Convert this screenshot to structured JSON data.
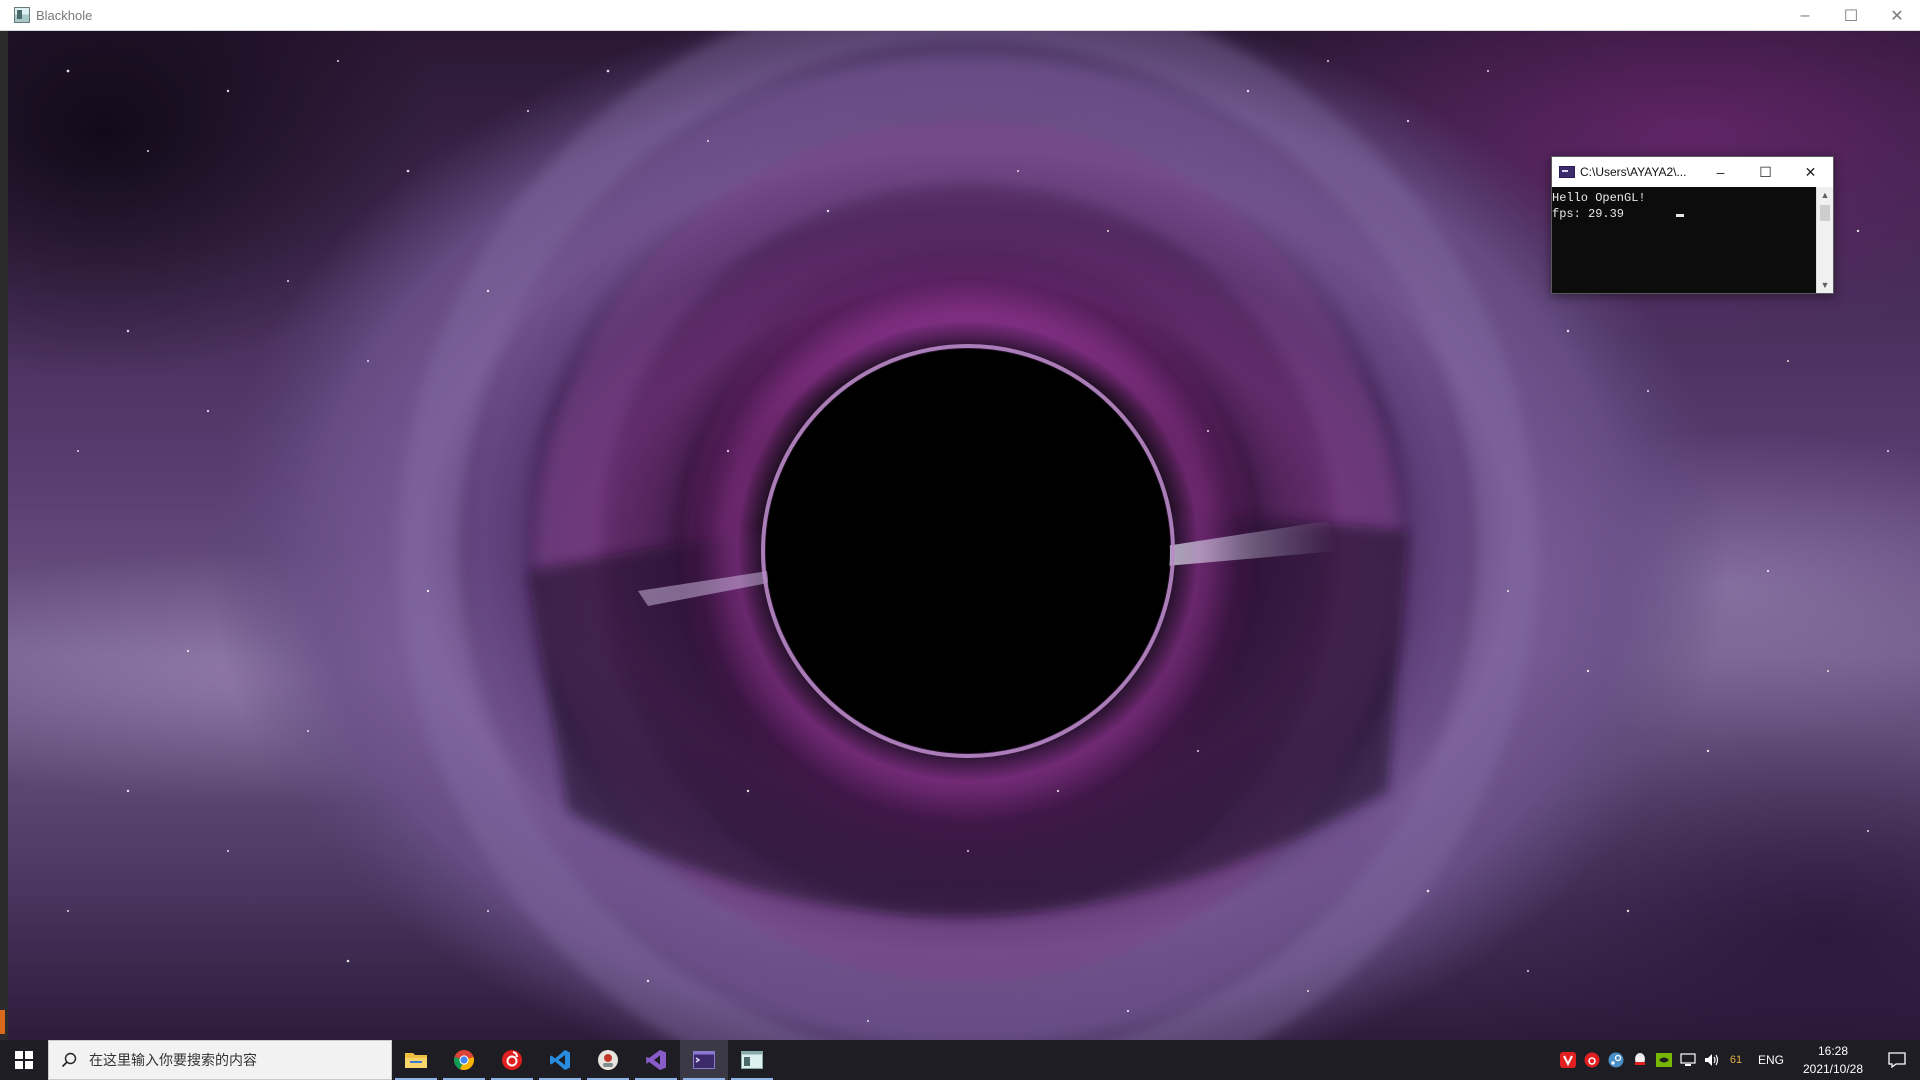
{
  "app": {
    "title": "Blackhole",
    "controls": {
      "minimize": "–",
      "maximize": "☐",
      "close": "✕"
    }
  },
  "console": {
    "title": "C:\\Users\\AYAYA2\\...",
    "lines": [
      "Hello OpenGL!",
      "fps: 29.39"
    ],
    "controls": {
      "minimize": "–",
      "maximize": "☐",
      "close": "✕"
    }
  },
  "taskbar": {
    "search_placeholder": "在这里输入你要搜索的内容",
    "apps": [
      {
        "name": "file-explorer-icon"
      },
      {
        "name": "chrome-icon"
      },
      {
        "name": "netease-music-icon"
      },
      {
        "name": "vscode-icon"
      },
      {
        "name": "app-icon"
      },
      {
        "name": "visual-studio-icon"
      },
      {
        "name": "console-icon"
      },
      {
        "name": "blackhole-app-icon"
      }
    ],
    "tray": {
      "battery_level": "61",
      "language": "ENG",
      "time": "16:28",
      "date": "2021/10/28"
    }
  },
  "colors": {
    "taskbar_bg": "#1f1d24",
    "console_bg": "#0c0c0c",
    "disk_purple": "#6b3d8a"
  }
}
